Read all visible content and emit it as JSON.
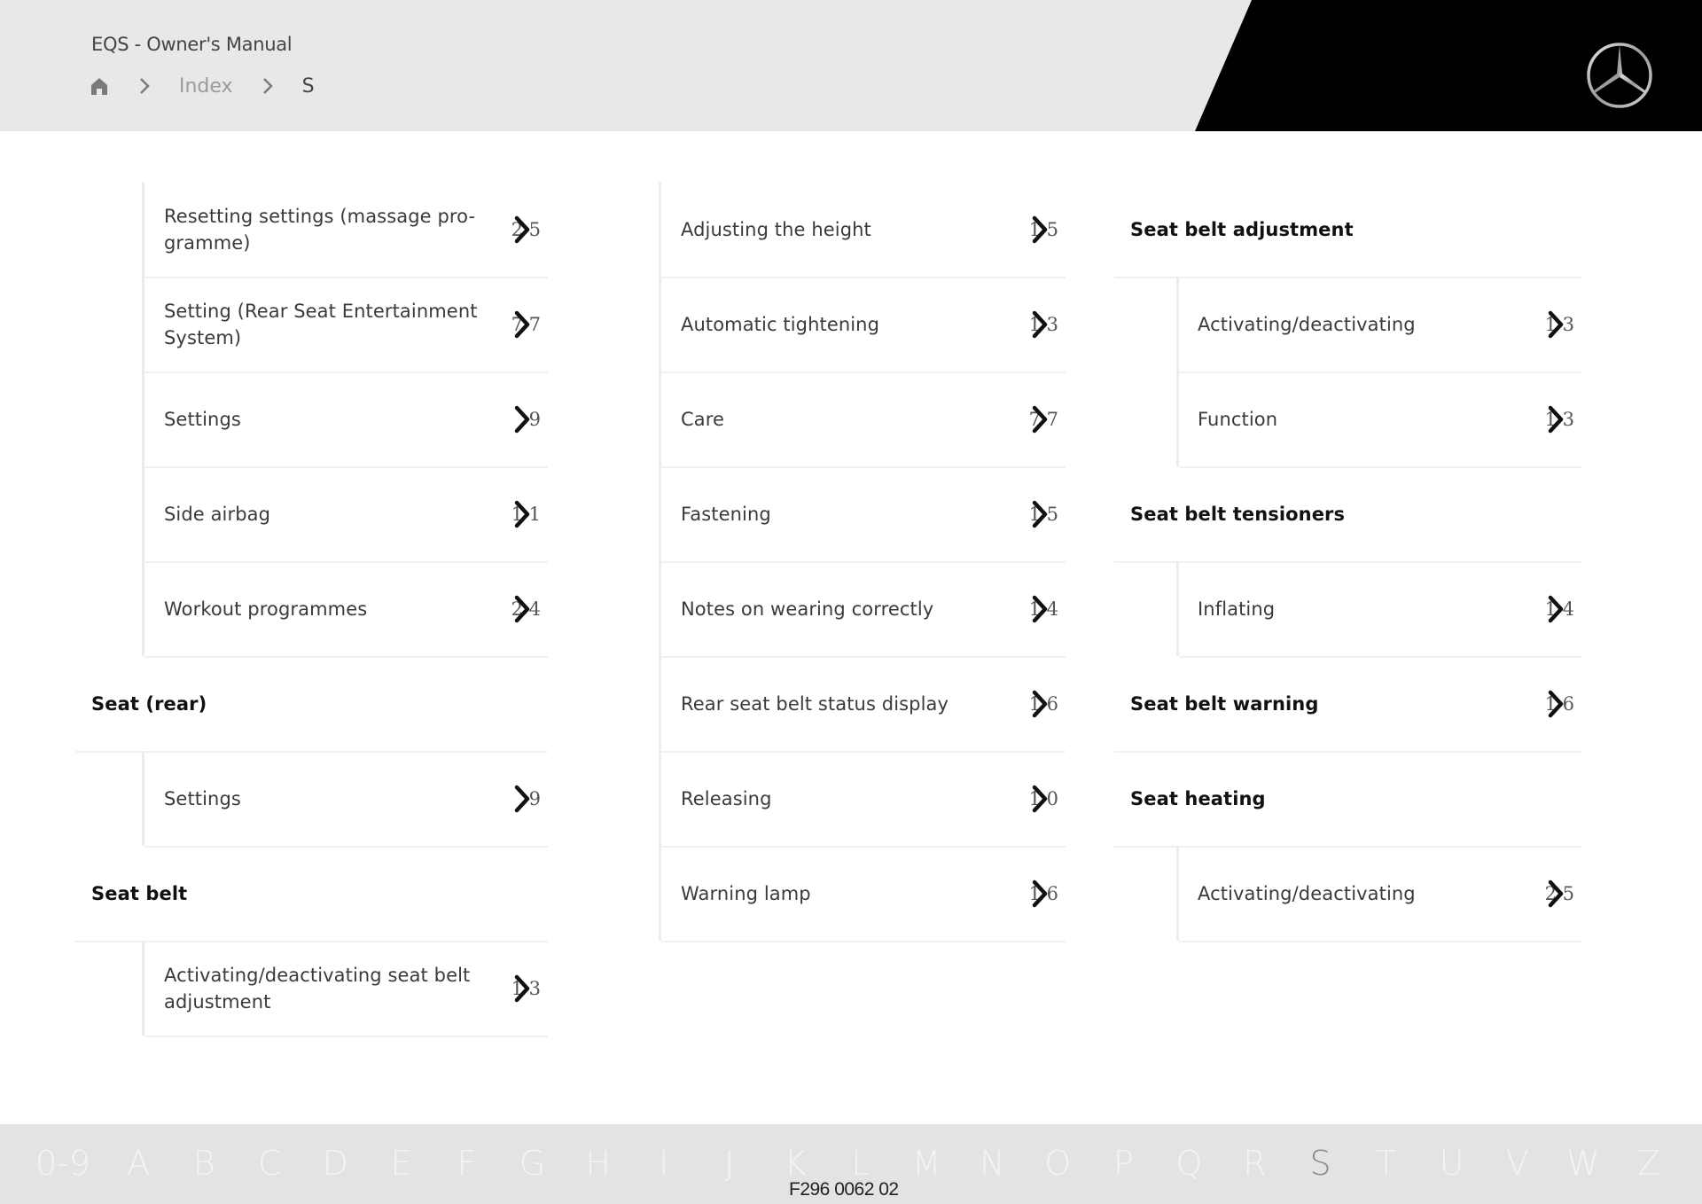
{
  "header": {
    "title": "EQS - Owner's Manual",
    "breadcrumb": [
      {
        "label": "home",
        "icon": "home-icon"
      },
      {
        "label": "Index"
      },
      {
        "label": "S"
      }
    ]
  },
  "brand": {
    "logo": "mercedes-star-icon",
    "panel_color": "#000000"
  },
  "columns": [
    {
      "rows": [
        {
          "type": "sub",
          "label": "Resetting settings (massage pro-\ngramme)",
          "page_visible": "2 5"
        },
        {
          "type": "sub",
          "label": "Setting (Rear Seat Entertainment\nSystem)",
          "page_visible": "7 7"
        },
        {
          "type": "sub",
          "label": "Settings",
          "page_visible": "9"
        },
        {
          "type": "sub",
          "label": "Side airbag",
          "page_visible": "1 1"
        },
        {
          "type": "sub",
          "label": "Workout programmes",
          "page_visible": "2 4"
        },
        {
          "type": "head",
          "label": "Seat (rear)",
          "page_visible": ""
        },
        {
          "type": "sub",
          "label": "Settings",
          "page_visible": "9"
        },
        {
          "type": "head",
          "label": "Seat belt",
          "page_visible": ""
        },
        {
          "type": "sub",
          "label": "Activating/deactivating seat belt\nadjustment",
          "page_visible": "1 3"
        }
      ]
    },
    {
      "rows": [
        {
          "type": "sub",
          "label": "Adjusting the height",
          "page_visible": "1 5"
        },
        {
          "type": "sub",
          "label": "Automatic tightening",
          "page_visible": "1 3"
        },
        {
          "type": "sub",
          "label": "Care",
          "page_visible": "7 7"
        },
        {
          "type": "sub",
          "label": "Fastening",
          "page_visible": "1 5"
        },
        {
          "type": "sub",
          "label": "Notes on wearing correctly",
          "page_visible": "1 4"
        },
        {
          "type": "sub",
          "label": "Rear seat belt status display",
          "page_visible": "1 6"
        },
        {
          "type": "sub",
          "label": "Releasing",
          "page_visible": "1 0"
        },
        {
          "type": "sub",
          "label": "Warning lamp",
          "page_visible": "1 6"
        }
      ]
    },
    {
      "rows": [
        {
          "type": "head",
          "label": "Seat belt adjustment",
          "page_visible": ""
        },
        {
          "type": "sub",
          "label": "Activating/deactivating",
          "page_visible": "1 3"
        },
        {
          "type": "sub",
          "label": "Function",
          "page_visible": "1 3"
        },
        {
          "type": "head",
          "label": "Seat belt tensioners",
          "page_visible": ""
        },
        {
          "type": "sub",
          "label": "Inflating",
          "page_visible": "1 4"
        },
        {
          "type": "head",
          "label": "Seat belt warning",
          "page_visible": "1 6"
        },
        {
          "type": "head",
          "label": "Seat heating",
          "page_visible": ""
        },
        {
          "type": "sub",
          "label": "Activating/deactivating",
          "page_visible": "2 5"
        }
      ]
    }
  ],
  "alphabet": {
    "letters": [
      "0-9",
      "A",
      "B",
      "C",
      "D",
      "E",
      "F",
      "G",
      "H",
      "I",
      "J",
      "K",
      "L",
      "M",
      "N",
      "O",
      "P",
      "Q",
      "R",
      "S",
      "T",
      "U",
      "V",
      "W",
      "Z"
    ],
    "active": "S"
  },
  "footer": {
    "doc_code": "F296 0062 02"
  }
}
